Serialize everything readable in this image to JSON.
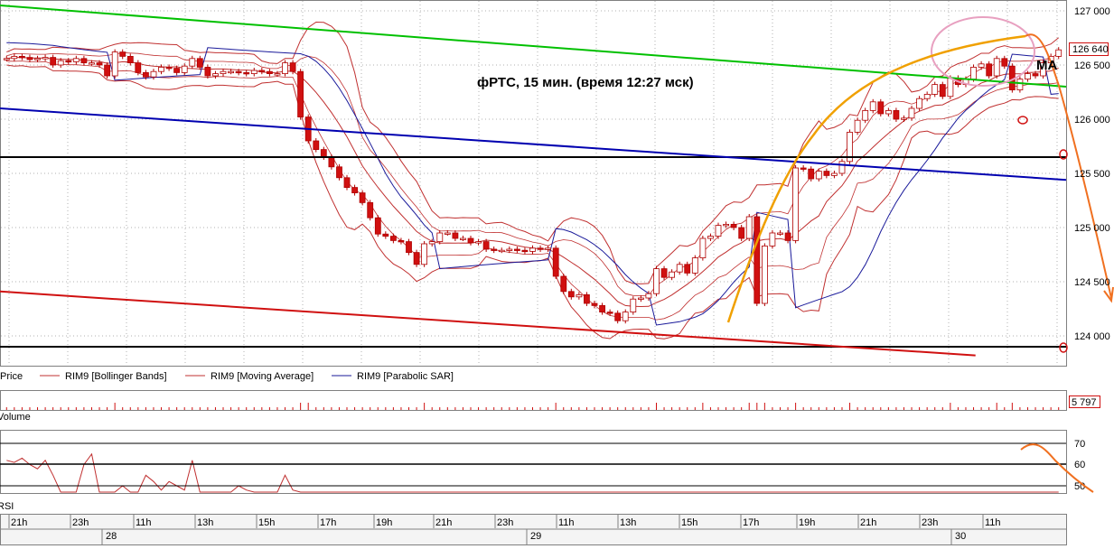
{
  "annotation": "фРТС,  15 мин. (время 12:27 мск)",
  "ma_annotation": "MA",
  "price_axis": {
    "ticks": [
      "127 000",
      "126 500",
      "126 000",
      "125 500",
      "125 000",
      "124 500",
      "124 000"
    ],
    "current_label": "126 640"
  },
  "legend": {
    "price": "Price",
    "bollinger": "RIM9 [Bollinger Bands]",
    "ma": "RIM9 [Moving Average]",
    "sar": "RIM9 [Parabolic SAR]"
  },
  "volume": {
    "label": "Volume",
    "current_label": "5 797"
  },
  "rsi": {
    "label": "RSI",
    "ticks": [
      "70",
      "60",
      "50"
    ]
  },
  "time_axis": {
    "hours": [
      "21h",
      "23h",
      "11h",
      "13h",
      "15h",
      "17h",
      "19h",
      "21h",
      "23h",
      "11h",
      "13h",
      "15h",
      "17h",
      "19h",
      "21h",
      "23h",
      "11h"
    ],
    "days": [
      "28",
      "29",
      "30"
    ]
  },
  "colors": {
    "candle_up": "#ffffff",
    "candle_down": "#d01010",
    "candle_edge": "#b00000",
    "bollinger": "#c03030",
    "ma": "#c03030",
    "sar": "#1a1a9a",
    "trend_green": "#00c000",
    "trend_blue": "#0000b0",
    "trend_red": "#d01010",
    "level_black": "#000000",
    "orange": "#f0a000",
    "pink": "#e8a0c0",
    "grid": "#b0b0b0"
  },
  "chart_data": {
    "type": "candlestick",
    "instrument": "RIM9",
    "ylim": [
      123850,
      127050
    ],
    "levels": [
      125650,
      123900
    ],
    "trendlines": [
      {
        "color": "green",
        "x0": 0,
        "y0": 127050,
        "x1": 1,
        "y1": 126300
      },
      {
        "color": "blue",
        "x0": 0,
        "y0": 126100,
        "x1": 1,
        "y1": 125440
      },
      {
        "color": "red",
        "x0": 0,
        "y0": 124410,
        "x1": 0.915,
        "y1": 123820
      }
    ],
    "price_series": [
      126560,
      126580,
      126570,
      126550,
      126560,
      126570,
      126500,
      126540,
      126530,
      126560,
      126520,
      126520,
      126500,
      126400,
      126620,
      126580,
      126520,
      126430,
      126390,
      126440,
      126480,
      126470,
      126430,
      126490,
      126560,
      126480,
      126400,
      126420,
      126440,
      126440,
      126430,
      126420,
      126450,
      126440,
      126420,
      126420,
      126520,
      126440,
      126020,
      125800,
      125720,
      125650,
      125560,
      125460,
      125370,
      125320,
      125230,
      125090,
      124940,
      124920,
      124880,
      124870,
      124770,
      124660,
      124850,
      124870,
      124950,
      124950,
      124900,
      124900,
      124860,
      124870,
      124800,
      124790,
      124790,
      124800,
      124790,
      124780,
      124810,
      124800,
      124810,
      124550,
      124410,
      124360,
      124380,
      124300,
      124280,
      124220,
      124210,
      124140,
      124220,
      124340,
      124350,
      124390,
      124620,
      124540,
      124590,
      124660,
      124580,
      124720,
      124900,
      124920,
      125020,
      125030,
      125000,
      124900,
      125100,
      124300,
      124830,
      124950,
      124950,
      124880,
      125550,
      125540,
      125450,
      125520,
      125480,
      125500,
      125610,
      125880,
      125990,
      126080,
      126160,
      126050,
      126080,
      126000,
      126010,
      126100,
      126190,
      126230,
      126320,
      126210,
      126380,
      126320,
      126370,
      126480,
      126510,
      126400,
      126560,
      126490,
      126270,
      126370,
      126420,
      126400,
      126520,
      126580,
      126640
    ],
    "rsi_series": [
      62,
      61,
      63,
      60,
      58,
      62,
      55,
      40,
      38,
      45,
      60,
      65,
      42,
      38,
      45,
      50,
      40,
      38,
      55,
      52,
      48,
      52,
      50,
      48,
      62,
      45,
      40,
      42,
      44,
      46,
      50,
      48,
      47,
      46,
      44,
      46,
      55,
      48,
      30,
      30,
      30,
      30,
      30,
      30,
      30,
      30,
      30,
      30,
      30,
      30,
      30,
      30,
      30,
      30,
      30,
      30,
      30,
      30,
      30,
      30,
      30,
      30,
      30,
      30,
      30,
      30,
      30,
      30,
      30,
      30,
      30,
      30,
      30,
      30,
      30,
      30,
      30,
      30,
      30,
      30,
      30,
      30,
      30,
      30,
      30,
      30,
      30,
      30,
      30,
      30,
      30,
      30,
      30,
      30,
      30,
      30,
      30,
      30,
      30,
      30,
      30,
      30,
      30,
      30,
      30,
      30,
      30,
      30,
      30,
      30,
      30,
      30,
      30,
      30,
      30,
      30,
      30,
      30,
      30,
      30,
      30,
      30,
      30,
      30,
      30,
      30,
      30,
      30,
      30,
      30,
      30,
      30,
      30,
      30,
      30,
      30,
      30
    ]
  }
}
